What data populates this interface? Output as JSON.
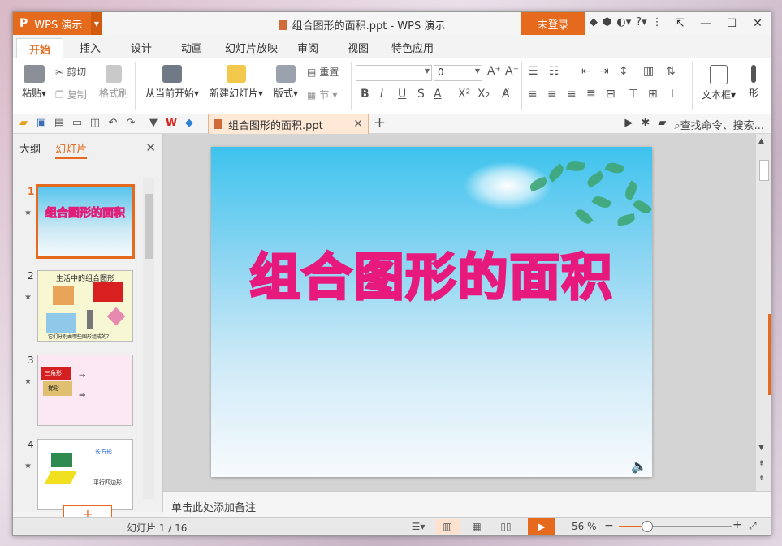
{
  "app": {
    "logo": "P",
    "name": "WPS 演示",
    "title": "组合图形的面积.ppt - WPS 演示",
    "login": "未登录",
    "title_icons": [
      "◆",
      "⬢",
      "◐▾",
      "?▾",
      "⋮"
    ],
    "win_controls": [
      "⇱",
      "—",
      "☐",
      "✕"
    ]
  },
  "menu": {
    "tabs": [
      "开始",
      "插入",
      "设计",
      "动画",
      "幻灯片放映",
      "审阅",
      "视图",
      "特色应用"
    ]
  },
  "ribbon": {
    "paste": "粘贴",
    "cut": "剪切",
    "copy": "复制",
    "format_painter": "格式刷",
    "from_current": "从当前开始",
    "new_slide": "新建幻灯片",
    "layout": "版式",
    "reset": "重置",
    "section": "节",
    "font_size": "0",
    "textbox": "文本框",
    "shape": "形"
  },
  "quickbar": {
    "doc_tab": "组合图形的面积.ppt",
    "search": "查找命令、搜索..."
  },
  "leftpane": {
    "tab_outline": "大纲",
    "tab_slides": "幻灯片",
    "slides": [
      {
        "num": "1",
        "title": "组合图形的面积"
      },
      {
        "num": "2",
        "title": "生活中的组合图形",
        "caption": "它们分别由哪些图形组成的？"
      },
      {
        "num": "3",
        "labels": [
          "三角形",
          "梯形"
        ]
      },
      {
        "num": "4",
        "labels": [
          "长方形",
          "平行四边形"
        ]
      }
    ],
    "add": "+"
  },
  "slide": {
    "title": "组合图形的面积"
  },
  "notes": {
    "placeholder": "单击此处添加备注"
  },
  "status": {
    "slide_info": "幻灯片 1 / 16",
    "zoom": "56 %",
    "zoom_fraction": 0.56
  },
  "colors": {
    "accent": "#e56a1d",
    "title_stroke": "#e8197d"
  }
}
